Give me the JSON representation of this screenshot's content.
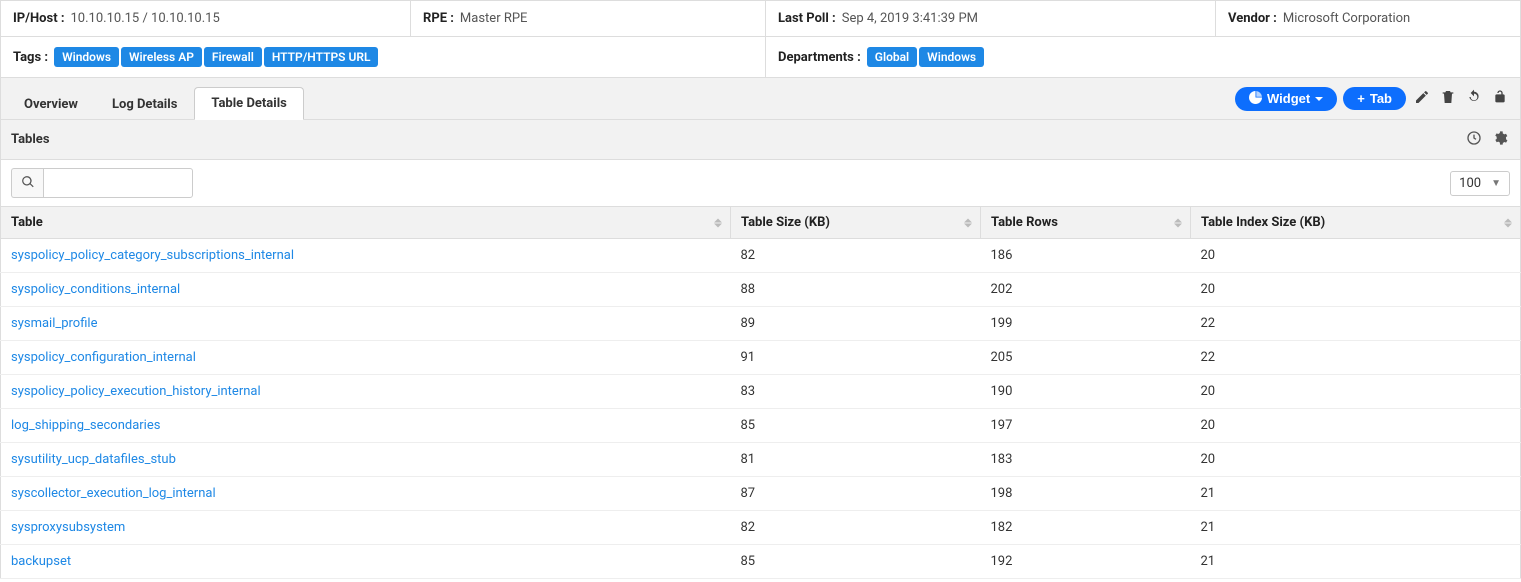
{
  "info": {
    "ip_host_label": "IP/Host :",
    "ip_host_value": "10.10.10.15 / 10.10.10.15",
    "rpe_label": "RPE :",
    "rpe_value": "Master RPE",
    "last_poll_label": "Last Poll :",
    "last_poll_value": "Sep 4, 2019 3:41:39 PM",
    "vendor_label": "Vendor :",
    "vendor_value": "Microsoft Corporation",
    "tags_label": "Tags :",
    "tags": [
      "Windows",
      "Wireless AP",
      "Firewall",
      "HTTP/HTTPS URL"
    ],
    "departments_label": "Departments :",
    "departments": [
      "Global",
      "Windows"
    ]
  },
  "tabs": [
    {
      "label": "Overview",
      "active": false
    },
    {
      "label": "Log Details",
      "active": false
    },
    {
      "label": "Table Details",
      "active": true
    }
  ],
  "buttons": {
    "widget_label": "Widget",
    "tab_label": "Tab"
  },
  "section": {
    "title": "Tables"
  },
  "search": {
    "value": ""
  },
  "page_size": "100",
  "columns": [
    {
      "label": "Table",
      "key": "name"
    },
    {
      "label": "Table Size (KB)",
      "key": "size"
    },
    {
      "label": "Table Rows",
      "key": "rows"
    },
    {
      "label": "Table Index Size (KB)",
      "key": "idx"
    }
  ],
  "rows": [
    {
      "name": "syspolicy_policy_category_subscriptions_internal",
      "size": "82",
      "rows": "186",
      "idx": "20"
    },
    {
      "name": "syspolicy_conditions_internal",
      "size": "88",
      "rows": "202",
      "idx": "20"
    },
    {
      "name": "sysmail_profile",
      "size": "89",
      "rows": "199",
      "idx": "22"
    },
    {
      "name": "syspolicy_configuration_internal",
      "size": "91",
      "rows": "205",
      "idx": "22"
    },
    {
      "name": "syspolicy_policy_execution_history_internal",
      "size": "83",
      "rows": "190",
      "idx": "20"
    },
    {
      "name": "log_shipping_secondaries",
      "size": "85",
      "rows": "197",
      "idx": "20"
    },
    {
      "name": "sysutility_ucp_datafiles_stub",
      "size": "81",
      "rows": "183",
      "idx": "20"
    },
    {
      "name": "syscollector_execution_log_internal",
      "size": "87",
      "rows": "198",
      "idx": "21"
    },
    {
      "name": "sysproxysubsystem",
      "size": "82",
      "rows": "182",
      "idx": "21"
    },
    {
      "name": "backupset",
      "size": "85",
      "rows": "192",
      "idx": "21"
    }
  ]
}
